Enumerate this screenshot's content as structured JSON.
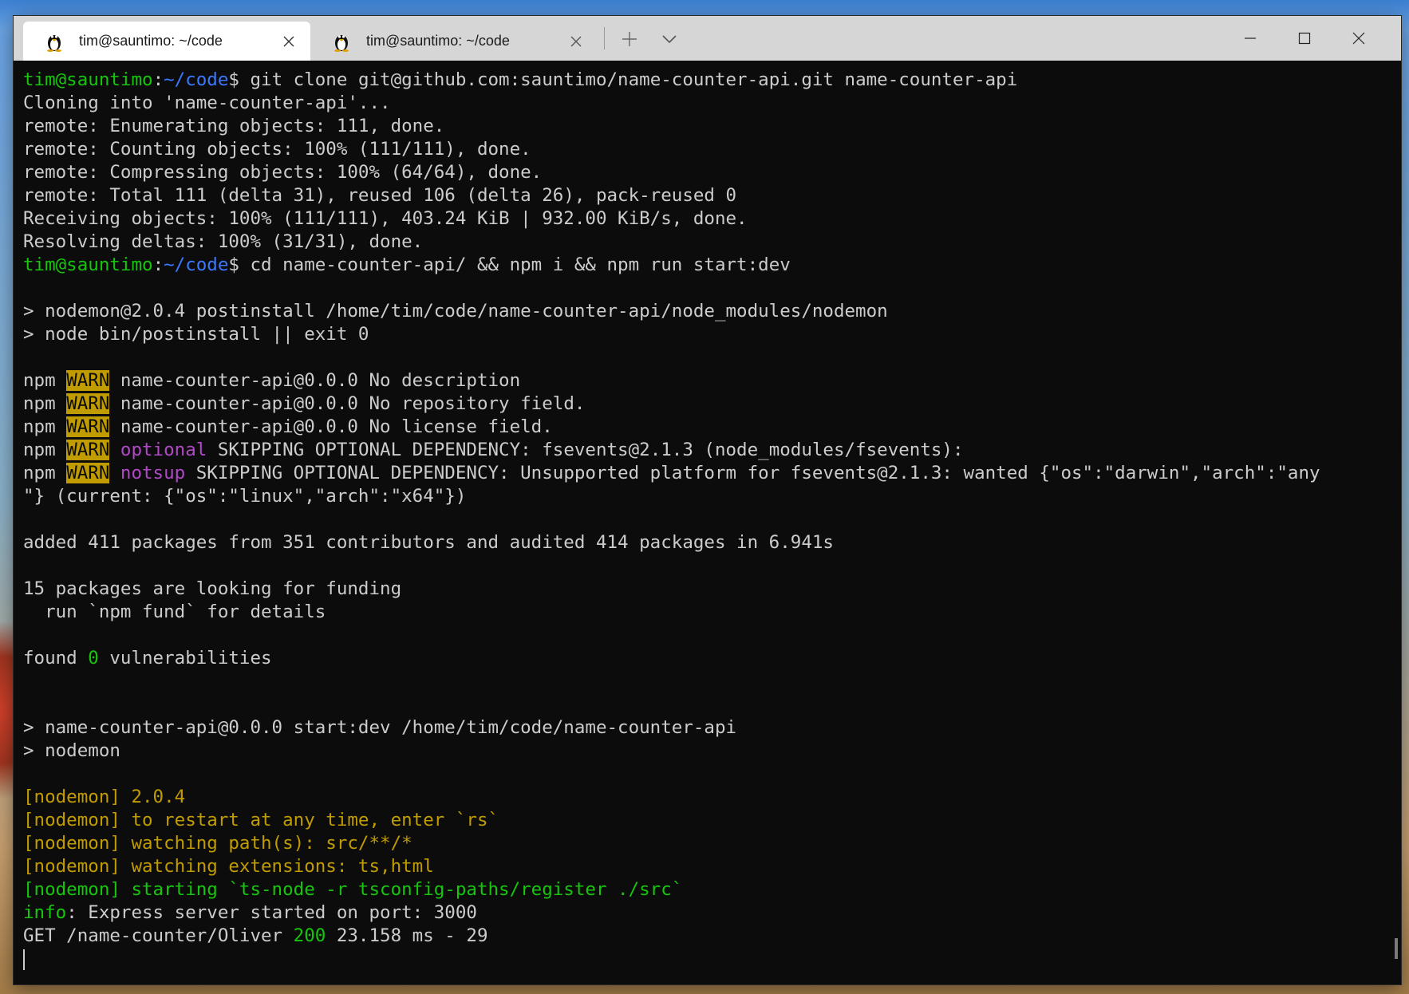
{
  "window": {
    "tabs": [
      {
        "title": "tim@sauntimo: ~/code",
        "active": true
      },
      {
        "title": "tim@sauntimo: ~/code",
        "active": false
      }
    ],
    "icons": {
      "tab": "linux-penguin-icon",
      "close_tab": "close-icon",
      "new_tab": "plus-icon",
      "dropdown": "chevron-down-icon",
      "minimize": "minimize-icon",
      "maximize": "maximize-icon",
      "close_window": "close-icon"
    }
  },
  "colors": {
    "terminal_bg": "#0c0c0c",
    "text": "#cccccc",
    "user_green": "#16c60c",
    "path_blue": "#3b78ff",
    "warn_yellow": "#c19c00",
    "magenta": "#b148c6"
  },
  "terminal": {
    "prompt": {
      "user": "tim@sauntimo",
      "sep": ":",
      "path": "~/code",
      "symbol": "$"
    },
    "lines": [
      [
        {
          "t": "tim@sauntimo",
          "c": "user"
        },
        {
          "t": ":"
        },
        {
          "t": "~/code",
          "c": "path"
        },
        {
          "t": "$ git clone git@github.com:sauntimo/name-counter-api.git name-counter-api"
        }
      ],
      [
        {
          "t": "Cloning into 'name-counter-api'..."
        }
      ],
      [
        {
          "t": "remote: Enumerating objects: 111, done."
        }
      ],
      [
        {
          "t": "remote: Counting objects: 100% (111/111), done."
        }
      ],
      [
        {
          "t": "remote: Compressing objects: 100% (64/64), done."
        }
      ],
      [
        {
          "t": "remote: Total 111 (delta 31), reused 106 (delta 26), pack-reused 0"
        }
      ],
      [
        {
          "t": "Receiving objects: 100% (111/111), 403.24 KiB | 932.00 KiB/s, done."
        }
      ],
      [
        {
          "t": "Resolving deltas: 100% (31/31), done."
        }
      ],
      [
        {
          "t": "tim@sauntimo",
          "c": "user"
        },
        {
          "t": ":"
        },
        {
          "t": "~/code",
          "c": "path"
        },
        {
          "t": "$ cd name-counter-api/ && npm i && npm run start:dev"
        }
      ],
      [],
      [
        {
          "t": "> nodemon@2.0.4 postinstall /home/tim/code/name-counter-api/node_modules/nodemon"
        }
      ],
      [
        {
          "t": "> node bin/postinstall || exit 0"
        }
      ],
      [],
      [
        {
          "t": "npm "
        },
        {
          "t": "WARN",
          "c": "warn"
        },
        {
          "t": " name-counter-api@0.0.0 No description"
        }
      ],
      [
        {
          "t": "npm "
        },
        {
          "t": "WARN",
          "c": "warn"
        },
        {
          "t": " name-counter-api@0.0.0 No repository field."
        }
      ],
      [
        {
          "t": "npm "
        },
        {
          "t": "WARN",
          "c": "warn"
        },
        {
          "t": " name-counter-api@0.0.0 No license field."
        }
      ],
      [
        {
          "t": "npm "
        },
        {
          "t": "WARN",
          "c": "warn"
        },
        {
          "t": " "
        },
        {
          "t": "optional",
          "c": "magenta"
        },
        {
          "t": " SKIPPING OPTIONAL DEPENDENCY: fsevents@2.1.3 (node_modules/fsevents):"
        }
      ],
      [
        {
          "t": "npm "
        },
        {
          "t": "WARN",
          "c": "warn"
        },
        {
          "t": " "
        },
        {
          "t": "notsup",
          "c": "magenta"
        },
        {
          "t": " SKIPPING OPTIONAL DEPENDENCY: Unsupported platform for fsevents@2.1.3: wanted {\"os\":\"darwin\",\"arch\":\"any"
        }
      ],
      [
        {
          "t": "\"} (current: {\"os\":\"linux\",\"arch\":\"x64\"})"
        }
      ],
      [],
      [
        {
          "t": "added 411 packages from 351 contributors and audited 414 packages in 6.941s"
        }
      ],
      [],
      [
        {
          "t": "15 packages are looking for funding"
        }
      ],
      [
        {
          "t": "  run `npm fund` for details"
        }
      ],
      [],
      [
        {
          "t": "found "
        },
        {
          "t": "0",
          "c": "green"
        },
        {
          "t": " vulnerabilities"
        }
      ],
      [],
      [],
      [
        {
          "t": "> name-counter-api@0.0.0 start:dev /home/tim/code/name-counter-api"
        }
      ],
      [
        {
          "t": "> nodemon"
        }
      ],
      [],
      [
        {
          "t": "[nodemon] 2.0.4",
          "c": "yellow"
        }
      ],
      [
        {
          "t": "[nodemon] to restart at any time, enter `rs`",
          "c": "yellow"
        }
      ],
      [
        {
          "t": "[nodemon] watching path(s): src/**/*",
          "c": "yellow"
        }
      ],
      [
        {
          "t": "[nodemon] watching extensions: ts,html",
          "c": "yellow"
        }
      ],
      [
        {
          "t": "[nodemon] starting `ts-node -r tsconfig-paths/register ./src`",
          "c": "green"
        }
      ],
      [
        {
          "t": "info",
          "c": "green"
        },
        {
          "t": ": Express server started on port: 3000"
        }
      ],
      [
        {
          "t": "GET /name-counter/Oliver "
        },
        {
          "t": "200",
          "c": "green"
        },
        {
          "t": " 23.158 ms - 29"
        }
      ],
      [
        {
          "cursor": true
        }
      ]
    ]
  }
}
